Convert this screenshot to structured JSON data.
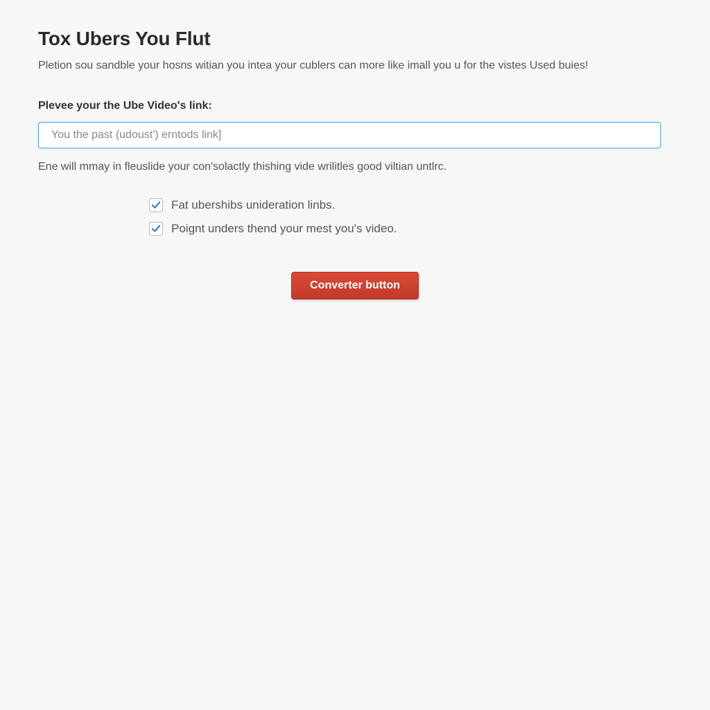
{
  "header": {
    "title": "Tox Ubers You Flut",
    "subtitle": "Pletion sou sandble your hosns witian you intea your cublers can more like imall you u for the vistes Used buies!"
  },
  "form": {
    "input_label": "Plevee your the Ube Video's link:",
    "input_placeholder": "You the past (udoust') erntods link]",
    "helper_text": "Ene will mmay in fleuslide your con'solactly thishing vide wrilitles good viltian untlrc."
  },
  "options": {
    "opt1": {
      "checked": true,
      "label": "Fat ubershibs unideration linbs."
    },
    "opt2": {
      "checked": true,
      "label": "Poignt unders thend your mest you's video."
    }
  },
  "actions": {
    "convert_label": "Converter button"
  }
}
